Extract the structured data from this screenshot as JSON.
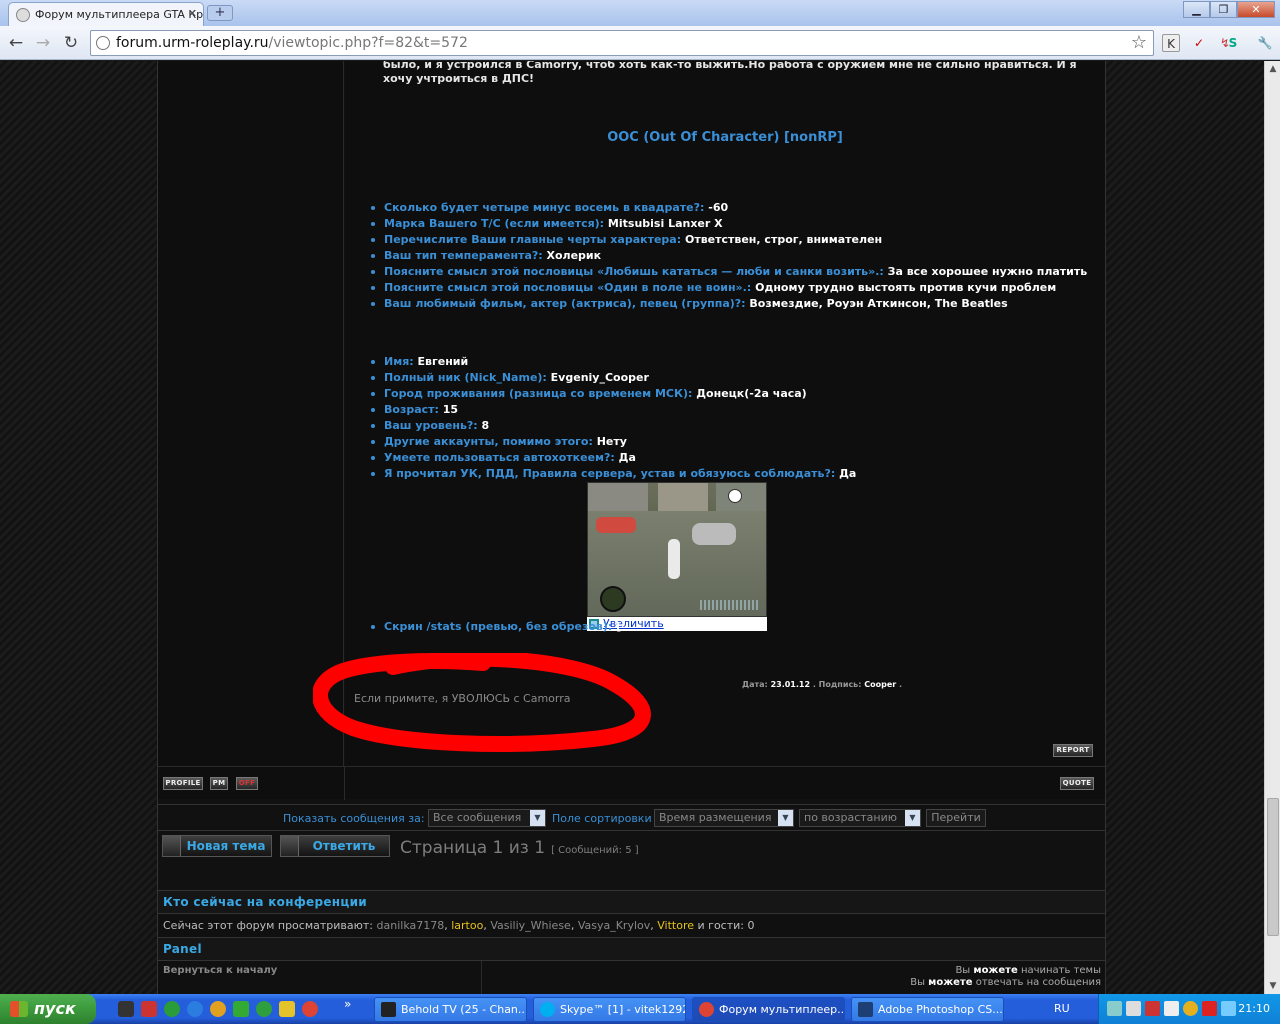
{
  "browser": {
    "tab_title": "Форум мультиплеера GTA Кр",
    "tab_close": "✕",
    "new_tab": "+",
    "url_host": "forum.urm-roleplay.ru",
    "url_path": "/viewtopic.php?f=82&t=572",
    "window_buttons": {
      "minimize": "▁",
      "maximize": "❐",
      "close": "✕"
    },
    "nav": {
      "back": "←",
      "forward": "→",
      "reload": "↻",
      "star": "☆",
      "wrench": "🔧"
    },
    "extensions": [
      "K",
      "✓",
      "↯",
      "S",
      "✎"
    ]
  },
  "post": {
    "intro_text": "было, и я устроился в Camorry, чтоб хоть как-то выжить.Но работа с оружием мне не сильно нравиться. И я хочу учтроиться в ДПС!",
    "ooc_heading": "OOC (Out Of Character) [nonRP]",
    "ooc_items": [
      {
        "q": "Сколько будет четыре минус восемь в квадрате?:",
        "a": "-60"
      },
      {
        "q": "Марка Вашего Т/С (если имеется):",
        "a": "Mitsubisi Lanxer X"
      },
      {
        "q": "Перечислите Ваши главные черты характера:",
        "a": "Ответствен, строг, внимателен"
      },
      {
        "q": "Ваш тип темперамента?:",
        "a": "Холерик"
      },
      {
        "q": "Поясните смысл этой пословицы «Любишь кататься — люби и санки возить».:",
        "a": "За все хорошее нужно платить"
      },
      {
        "q": "Поясните смысл этой пословицы «Один в поле не воин».:",
        "a": "Одному трудно выстоять против кучи проблем"
      },
      {
        "q": "Ваш любимый фильм, актер (актриса), певец (группа)?:",
        "a": "Возмездие, Роуэн Аткинсон, The Beatles"
      }
    ],
    "personal_items": [
      {
        "q": "Имя:",
        "a": "Евгений"
      },
      {
        "q": "Полный ник (Nick_Name):",
        "a": "Evgeniy_Cooper"
      },
      {
        "q": "Город проживания (разница со временем МСК):",
        "a": "Донецк(-2а часа)"
      },
      {
        "q": "Возраст:",
        "a": "15"
      },
      {
        "q": "Ваш уровень?:",
        "a": "8"
      },
      {
        "q": "Другие аккаунты, помимо этого:",
        "a": "Нету"
      },
      {
        "q": "Умеете пользоваться автохоткеем?:",
        "a": "Да"
      },
      {
        "q": "Я прочитал УК, ПДД, Правила сервера, устав и обязуюсь соблюдать?:",
        "a": "Да"
      }
    ],
    "screenshot_item_q": "Скрин /stats (превью, без обрезов):",
    "screenshot_item_a": "[",
    "enlarge_link": "Увеличить",
    "date_label": "Дата:",
    "date_value": "23.01.12",
    "sign_label": "Подпись:",
    "sign_value": "Cooper",
    "signature_note": "Если примите, я УВОЛЮСЬ с Camorra",
    "btn_report": "REPORT",
    "btn_profile": "PROFILE",
    "btn_pm": "PM",
    "btn_off": "OFF",
    "btn_quote": "QUOTE"
  },
  "sortbar": {
    "show_label": "Показать сообщения за:",
    "show_value": "Все сообщения",
    "sort_label": "Поле сортировки",
    "sort_value": "Время размещения",
    "order_value": "по возрастанию",
    "go_label": "Перейти",
    "dropdown_glyph": "▼"
  },
  "actions": {
    "new_topic": "Новая тема",
    "reply": "Ответить",
    "page_info": "Страница 1 из 1",
    "post_count": "[ Сообщений: 5 ]"
  },
  "online": {
    "header": "Кто сейчас на конференции",
    "prefix": "Сейчас этот форум просматривают:",
    "users": [
      "danilka7178",
      "lartoo",
      "Vasiliy_Whiese",
      "Vasya_Krylov",
      "Vittore"
    ],
    "guests": "и гости: 0"
  },
  "panel": {
    "header": "Panel",
    "back_to_top": "Вернуться к началу",
    "perm1_pre": "Вы",
    "perm1_bold": "можете",
    "perm1_post": "начинать темы",
    "perm2_pre": "Вы",
    "perm2_bold": "можете",
    "perm2_post": "отвечать на сообщения"
  },
  "taskbar": {
    "start": "пуск",
    "more": "»",
    "tasks": [
      "Behold TV (25 - Chan...",
      "Skype™ [1] - vitek1292",
      "Форум мультиплеер...",
      "Adobe Photoshop CS..."
    ],
    "lang": "RU",
    "clock": "21:10"
  },
  "colors": {
    "question_blue": "#3a8fd6",
    "answer_white": "#ffffff",
    "moderator_yellow": "#e6c21e",
    "red_mark": "#ff0000"
  }
}
